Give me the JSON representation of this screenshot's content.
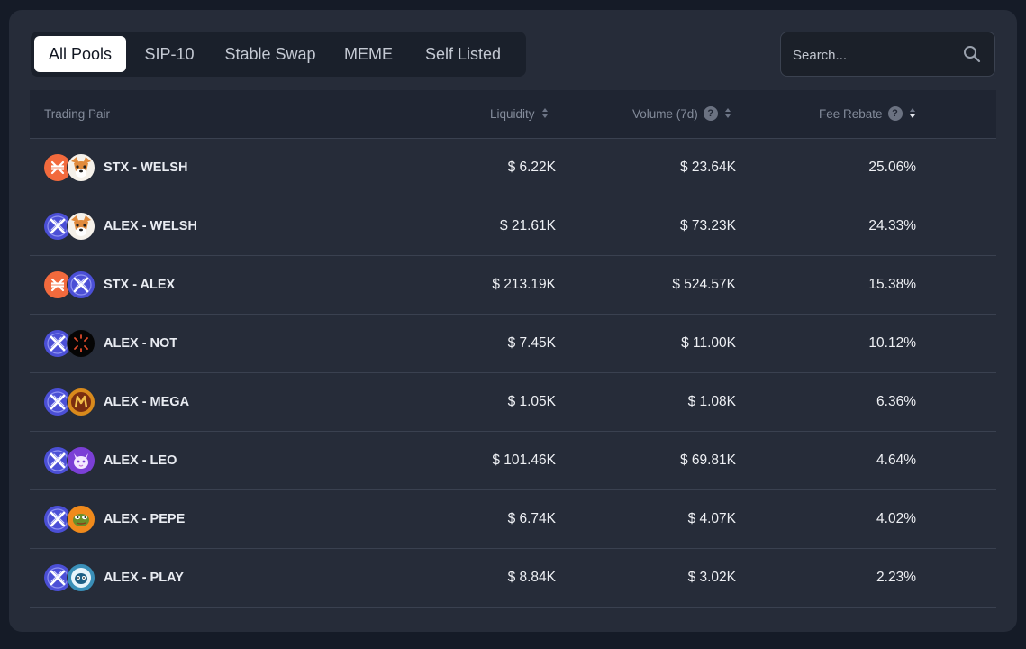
{
  "tabs": [
    {
      "label": "All Pools",
      "active": true
    },
    {
      "label": "SIP-10",
      "active": false
    },
    {
      "label": "Stable Swap",
      "active": false
    },
    {
      "label": "MEME",
      "active": false
    },
    {
      "label": "Self Listed",
      "active": false
    }
  ],
  "search": {
    "placeholder": "Search..."
  },
  "table": {
    "headers": {
      "pair": "Trading Pair",
      "liquidity": "Liquidity",
      "volume": "Volume (7d)",
      "fee": "Fee Rebate",
      "help": "?"
    },
    "rows": [
      {
        "pair": "STX - WELSH",
        "liquidity": "$ 6.22K",
        "volume": "$ 23.64K",
        "fee": "25.06%",
        "icons": [
          "stx-icon",
          "welsh-icon"
        ]
      },
      {
        "pair": "ALEX - WELSH",
        "liquidity": "$ 21.61K",
        "volume": "$ 73.23K",
        "fee": "24.33%",
        "icons": [
          "alex-icon",
          "welsh-icon"
        ]
      },
      {
        "pair": "STX - ALEX",
        "liquidity": "$ 213.19K",
        "volume": "$ 524.57K",
        "fee": "15.38%",
        "icons": [
          "stx-icon",
          "alex-icon"
        ]
      },
      {
        "pair": "ALEX - NOT",
        "liquidity": "$ 7.45K",
        "volume": "$ 11.00K",
        "fee": "10.12%",
        "icons": [
          "alex-icon",
          "not-icon"
        ]
      },
      {
        "pair": "ALEX - MEGA",
        "liquidity": "$ 1.05K",
        "volume": "$ 1.08K",
        "fee": "6.36%",
        "icons": [
          "alex-icon",
          "mega-icon"
        ]
      },
      {
        "pair": "ALEX - LEO",
        "liquidity": "$ 101.46K",
        "volume": "$ 69.81K",
        "fee": "4.64%",
        "icons": [
          "alex-icon",
          "leo-icon"
        ]
      },
      {
        "pair": "ALEX - PEPE",
        "liquidity": "$ 6.74K",
        "volume": "$ 4.07K",
        "fee": "4.02%",
        "icons": [
          "alex-icon",
          "pepe-icon"
        ]
      },
      {
        "pair": "ALEX - PLAY",
        "liquidity": "$ 8.84K",
        "volume": "$ 3.02K",
        "fee": "2.23%",
        "icons": [
          "alex-icon",
          "play-icon"
        ]
      }
    ]
  },
  "colors": {
    "background": "#151b27",
    "panel": "#262c39",
    "stx": "#f26a3d",
    "alex": "#4b4fd6",
    "welsh": "#e08a3c",
    "pepe": "#f08a1c"
  }
}
